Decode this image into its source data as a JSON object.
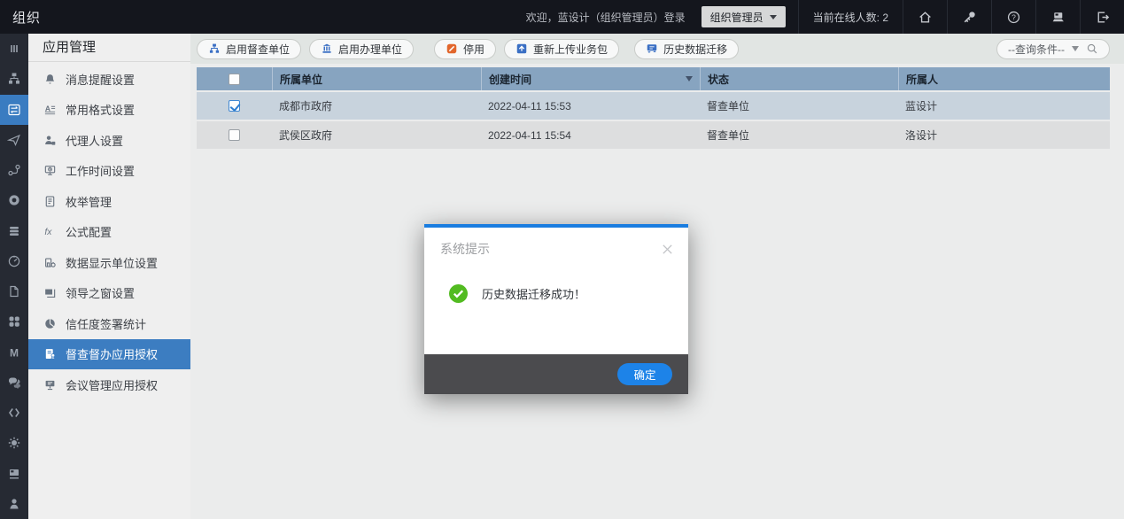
{
  "topbar": {
    "app_title": "组织",
    "welcome": "欢迎，蓝设计（组织管理员）登录",
    "role_label": "组织管理员",
    "online_label": "当前在线人数: 2",
    "icons": [
      "home-icon",
      "key-icon",
      "help-icon",
      "workstation-icon",
      "logout-icon"
    ]
  },
  "rail": {
    "icons": [
      "menu-bars-icon",
      "org-tree-icon",
      "app-settings-icon",
      "send-icon",
      "flow-icon",
      "medal-icon",
      "stack-icon",
      "gauge-icon",
      "file-icon",
      "apps-icon",
      "letter-m-icon",
      "chat-icon",
      "code-icon",
      "gear-icon",
      "monitor-icon",
      "person-icon"
    ],
    "active_index": 2
  },
  "sidebar": {
    "title": "应用管理",
    "items": [
      {
        "label": "消息提醒设置",
        "icon": "bell-icon"
      },
      {
        "label": "常用格式设置",
        "icon": "text-format-icon"
      },
      {
        "label": "代理人设置",
        "icon": "agent-icon"
      },
      {
        "label": "工作时间设置",
        "icon": "work-time-icon"
      },
      {
        "label": "枚举管理",
        "icon": "document-icon"
      },
      {
        "label": "公式配置",
        "icon": "formula-icon"
      },
      {
        "label": "数据显示单位设置",
        "icon": "unit-icon"
      },
      {
        "label": "领导之窗设置",
        "icon": "window-icon"
      },
      {
        "label": "信任度签署统计",
        "icon": "pie-chart-icon"
      },
      {
        "label": "督查督办应用授权",
        "icon": "authorization-icon"
      },
      {
        "label": "会议管理应用授权",
        "icon": "meeting-icon"
      }
    ],
    "active_index": 9
  },
  "toolbar": {
    "buttons": [
      {
        "label": "启用督查单位",
        "icon": "org-small-icon"
      },
      {
        "label": "启用办理单位",
        "icon": "building-icon"
      },
      {
        "label": "停用",
        "icon": "stop-icon"
      },
      {
        "label": "重新上传业务包",
        "icon": "upload-icon"
      },
      {
        "label": "历史数据迁移",
        "icon": "migrate-icon"
      }
    ],
    "query_label": "--查询条件--"
  },
  "table": {
    "headers": {
      "unit": "所属单位",
      "created": "创建时间",
      "status": "状态",
      "owner": "所属人"
    },
    "rows": [
      {
        "checked": true,
        "unit": "成都市政府",
        "created": "2022-04-11 15:53",
        "status": "督查单位",
        "owner": "蓝设计"
      },
      {
        "checked": false,
        "unit": "武侯区政府",
        "created": "2022-04-11 15:54",
        "status": "督查单位",
        "owner": "洛设计"
      }
    ]
  },
  "modal": {
    "title": "系统提示",
    "message": "历史数据迁移成功！",
    "ok_label": "确定",
    "success_color": "#52bb21",
    "accent_color": "#1a7de0"
  }
}
